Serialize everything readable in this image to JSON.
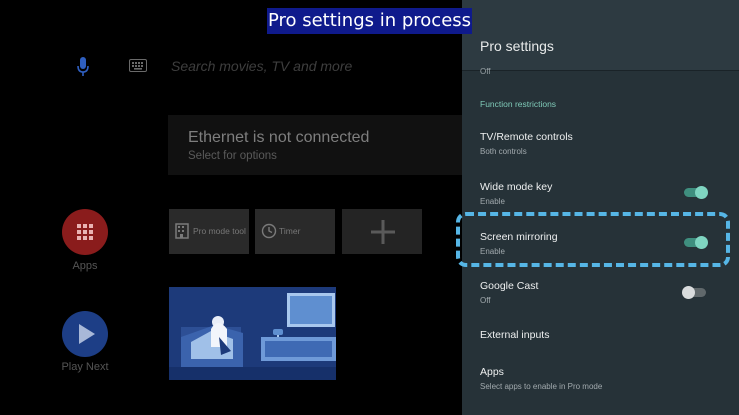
{
  "banner": "Pro settings in process",
  "launcher": {
    "search_placeholder": "Search movies, TV and more",
    "ethernet_title": "Ethernet is not connected",
    "ethernet_sub": "Select for options",
    "apps_label": "Apps",
    "play_next_label": "Play Next",
    "tiles": [
      "Pro mode tool",
      "Timer"
    ]
  },
  "panel": {
    "title": "Pro settings",
    "prev_sub": "Off",
    "section": "Function restrictions",
    "items": [
      {
        "title": "TV/Remote controls",
        "sub": "Both controls"
      },
      {
        "title": "Wide mode key",
        "sub": "Enable",
        "toggle": true
      },
      {
        "title": "Screen mirroring",
        "sub": "Enable",
        "toggle": true
      },
      {
        "title": "Google Cast",
        "sub": "Off",
        "toggle": false
      },
      {
        "title": "External inputs"
      },
      {
        "title": "Apps",
        "sub": "Select apps to enable in Pro mode"
      }
    ]
  },
  "colors": {
    "panel_bg": "#263238",
    "accent": "#7fd5c1",
    "highlight": "#56b6e6",
    "banner_bg": "#0f1a8c",
    "apps_red": "#8a1c1c",
    "play_blue": "#1d3e86"
  }
}
